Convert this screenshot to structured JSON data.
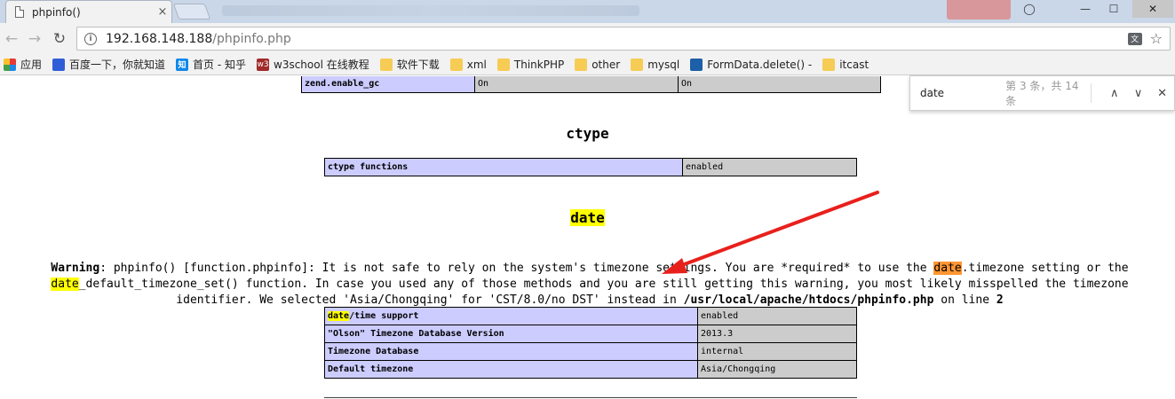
{
  "tab": {
    "title": "phpinfo()",
    "close": "×"
  },
  "window": {
    "minimize": "—",
    "maximize": "☐",
    "close": "✕",
    "user": "◯"
  },
  "address": {
    "host": "192.168.148.188",
    "path": "/phpinfo.php"
  },
  "bookmarks": [
    {
      "label": "应用",
      "icon": "apps-icon"
    },
    {
      "label": "百度一下，你就知道",
      "icon": "baidu-icon"
    },
    {
      "label": "首页 - 知乎",
      "icon": "zhihu-icon",
      "glyph": "知"
    },
    {
      "label": "w3school 在线教程",
      "icon": "w3school-icon",
      "glyph": "w3"
    },
    {
      "label": "软件下载",
      "icon": "folder-icon"
    },
    {
      "label": "xml",
      "icon": "folder-icon"
    },
    {
      "label": "ThinkPHP",
      "icon": "folder-icon"
    },
    {
      "label": "other",
      "icon": "folder-icon"
    },
    {
      "label": "mysql",
      "icon": "folder-icon"
    },
    {
      "label": "FormData.delete() -",
      "icon": "formdata-icon"
    },
    {
      "label": "itcast",
      "icon": "folder-icon"
    }
  ],
  "find": {
    "query": "date",
    "count": "第 3 条，共 14 条",
    "prev": "∧",
    "next": "∨",
    "close": "✕"
  },
  "zend": {
    "key": "zend.enable_gc",
    "local": "On",
    "master": "On"
  },
  "ctype": {
    "title": "ctype",
    "rows": [
      {
        "key": "ctype functions",
        "value": "enabled"
      }
    ]
  },
  "date": {
    "title": "date",
    "warning": {
      "label": "Warning",
      "sep": ": ",
      "t1": "phpinfo() [",
      "link": "function.phpinfo",
      "t2": "]: It is not safe to rely on the system's timezone settings. You are *required* to use the ",
      "hl1": "date",
      "t3": ".timezone setting or the ",
      "hl2": "date",
      "t4": "_default_timezone_set() function. In case you used any of those methods and you are still getting this warning, you most likely misspelled the timezone identifier. We selected 'Asia/Chongqing' for 'CST/8.0/no DST' instead in ",
      "file": "/usr/local/apache/htdocs/phpinfo.php",
      "t5": " on line ",
      "line": "2"
    },
    "rows": [
      {
        "key_hl": "date",
        "key": "/time support",
        "value": "enabled"
      },
      {
        "key_hl": "",
        "key": "\"Olson\" Timezone Database Version",
        "value": "2013.3"
      },
      {
        "key_hl": "",
        "key": "Timezone Database",
        "value": "internal"
      },
      {
        "key_hl": "",
        "key": "Default timezone",
        "value": "Asia/Chongqing"
      }
    ]
  },
  "colors": {
    "arrow": "#e8201c",
    "highlight": "#ffff00",
    "current_match": "#ff9632",
    "key_cell": "#ccccff",
    "value_cell": "#cccccc"
  }
}
